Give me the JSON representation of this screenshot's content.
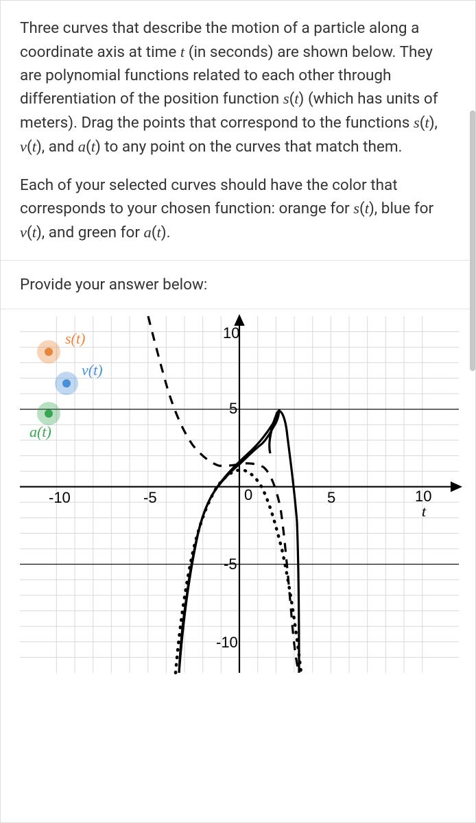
{
  "problem": {
    "paragraph1": "Three curves that describe the motion of a particle along a coordinate axis at time t (in seconds) are shown below. They are polynomial functions related to each other through differentiation of the position function s(t) (which has units of meters). Drag the points that correspond to the functions s(t), v(t), and a(t) to any point on the curves that match them.",
    "paragraph2": "Each of your selected curves should have the color that corresponds to your chosen function: orange for s(t), blue for v(t), and green for a(t)."
  },
  "prompt": "Provide your answer below:",
  "legend": {
    "s": {
      "label": "s(t)",
      "color": "#e8863d"
    },
    "v": {
      "label": "v(t)",
      "color": "#4a90d9"
    },
    "a": {
      "label": "a(t)",
      "color": "#3aa655"
    }
  },
  "chart_data": {
    "type": "line",
    "title": "",
    "xlabel": "t",
    "ylabel": "",
    "xlim": [
      -12,
      12
    ],
    "ylim": [
      -12,
      11
    ],
    "xticks": [
      -10,
      -5,
      0,
      5,
      10
    ],
    "yticks": [
      -10,
      -5,
      5,
      10
    ],
    "grid": true,
    "series": [
      {
        "name": "solid-curve",
        "style": "solid",
        "x": [
          -3.3,
          -3,
          -2.5,
          -2,
          -1.5,
          -1,
          -0.5,
          0,
          0.5,
          1,
          1.5,
          2,
          2.5,
          3,
          3.2
        ],
        "y": [
          -11,
          -8,
          -4.5,
          -2,
          -0.5,
          0.3,
          0.9,
          1.5,
          2.3,
          3.3,
          4.2,
          4.7,
          3.8,
          0,
          -11
        ]
      },
      {
        "name": "dashed-curve",
        "style": "dashed",
        "x": [
          -5,
          -4.5,
          -4,
          -3.5,
          -3,
          -2.5,
          -2,
          -1.5,
          -1,
          -0.5,
          0,
          0.5,
          1,
          1.5,
          2,
          2.5,
          3,
          3.3
        ],
        "y": [
          11,
          9.5,
          7.5,
          5.6,
          4,
          2.8,
          2,
          1.5,
          1.3,
          1.35,
          1.5,
          1.6,
          1.5,
          1,
          0,
          -2,
          -6.5,
          -11
        ]
      },
      {
        "name": "dotted-curve",
        "style": "dotted",
        "x": [
          -3.5,
          -3,
          -2.5,
          -2,
          -1.5,
          -1,
          -0.5,
          0,
          0.5,
          1,
          1.5,
          2,
          2.5,
          3,
          3.5
        ],
        "y": [
          -11,
          -8,
          -5.5,
          -3.5,
          -1.8,
          -0.5,
          0.3,
          0.8,
          0.9,
          0.5,
          -0.5,
          -2,
          -4.2,
          -7.2,
          -11
        ]
      }
    ]
  }
}
